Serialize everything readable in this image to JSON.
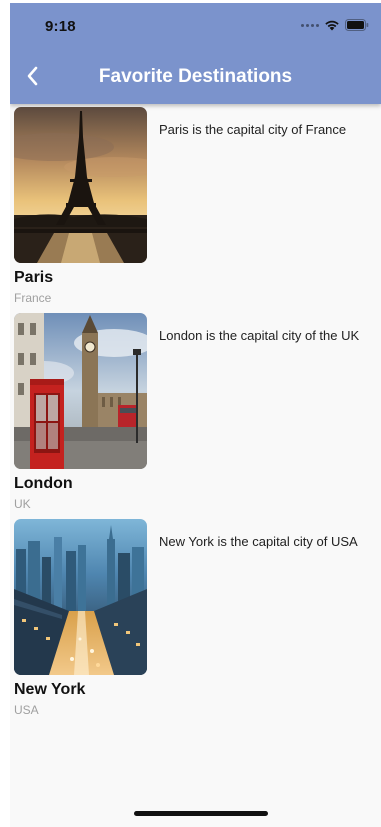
{
  "status_bar": {
    "time": "9:18",
    "icons": [
      "signal-dots-icon",
      "wifi-icon",
      "battery-icon"
    ]
  },
  "app_bar": {
    "title": "Favorite Destinations",
    "back_icon": "chevron-left-icon",
    "background_color": "#7b93cc"
  },
  "destinations": [
    {
      "city": "Paris",
      "country": "France",
      "description": "Paris is the capital city of France",
      "image": "eiffel-tower-photo"
    },
    {
      "city": "London",
      "country": "UK",
      "description": "London is the capital city of the UK",
      "image": "big-ben-phone-booth-photo"
    },
    {
      "city": "New York",
      "country": "USA",
      "description": "New York is the capital city of USA",
      "image": "manhattan-skyline-photo"
    }
  ]
}
